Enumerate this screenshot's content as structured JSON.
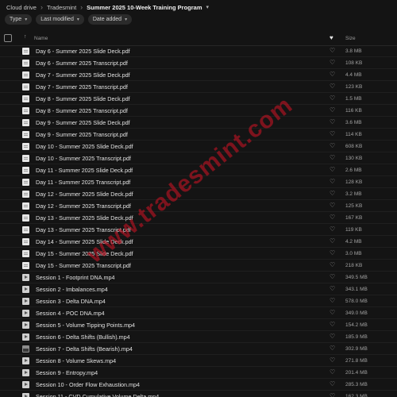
{
  "breadcrumb": {
    "root": "Cloud drive",
    "parent": "Tradesmint",
    "current": "Summer 2025 10-Week Training Program"
  },
  "filters": [
    {
      "label": "Type"
    },
    {
      "label": "Last modified"
    },
    {
      "label": "Date added"
    }
  ],
  "table_header": {
    "name": "Name",
    "size": "Size"
  },
  "watermark": "www.tradesmint.com",
  "files": [
    {
      "name": "Day 6 - Summer 2025 Slide Deck.pdf",
      "size": "3.8 MB",
      "icon": "pdf"
    },
    {
      "name": "Day 6 - Summer 2025 Transcript.pdf",
      "size": "108 KB",
      "icon": "pdf"
    },
    {
      "name": "Day 7 - Summer 2025 Slide Deck.pdf",
      "size": "4.4 MB",
      "icon": "pdf"
    },
    {
      "name": "Day 7 - Summer 2025 Transcript.pdf",
      "size": "123 KB",
      "icon": "pdf"
    },
    {
      "name": "Day 8 - Summer 2025 Slide Deck.pdf",
      "size": "1.5 MB",
      "icon": "pdf"
    },
    {
      "name": "Day 8 - Summer 2025 Transcript.pdf",
      "size": "116 KB",
      "icon": "pdf"
    },
    {
      "name": "Day 9 - Summer 2025 Slide Deck.pdf",
      "size": "3.6 MB",
      "icon": "pdf"
    },
    {
      "name": "Day 9 - Summer 2025 Transcript.pdf",
      "size": "114 KB",
      "icon": "pdf"
    },
    {
      "name": "Day 10 - Summer 2025 Slide Deck.pdf",
      "size": "608 KB",
      "icon": "pdf"
    },
    {
      "name": "Day 10 - Summer 2025 Transcript.pdf",
      "size": "130 KB",
      "icon": "pdf"
    },
    {
      "name": "Day 11 - Summer 2025 Slide Deck.pdf",
      "size": "2.6 MB",
      "icon": "pdf"
    },
    {
      "name": "Day 11 - Summer 2025 Transcript.pdf",
      "size": "128 KB",
      "icon": "pdf"
    },
    {
      "name": "Day 12 - Summer 2025 Slide Deck.pdf",
      "size": "3.2 MB",
      "icon": "pdf"
    },
    {
      "name": "Day 12 - Summer 2025 Transcript.pdf",
      "size": "125 KB",
      "icon": "pdf"
    },
    {
      "name": "Day 13 - Summer 2025 Slide Deck.pdf",
      "size": "167 KB",
      "icon": "pdf"
    },
    {
      "name": "Day 13 - Summer 2025 Transcript.pdf",
      "size": "119 KB",
      "icon": "pdf"
    },
    {
      "name": "Day 14 - Summer 2025 Slide Deck.pdf",
      "size": "4.2 MB",
      "icon": "pdf"
    },
    {
      "name": "Day 15 - Summer 2025 Slide Deck.pdf",
      "size": "3.0 MB",
      "icon": "pdf"
    },
    {
      "name": "Day 15 - Summer 2025 Transcript.pdf",
      "size": "218 KB",
      "icon": "pdf"
    },
    {
      "name": "Session 1 - Footprint DNA.mp4",
      "size": "349.5 MB",
      "icon": "mp4"
    },
    {
      "name": "Session 2 - Imbalances.mp4",
      "size": "343.1 MB",
      "icon": "mp4"
    },
    {
      "name": "Session 3 - Delta DNA.mp4",
      "size": "578.0 MB",
      "icon": "mp4"
    },
    {
      "name": "Session 4 - POC DNA.mp4",
      "size": "349.0 MB",
      "icon": "mp4"
    },
    {
      "name": "Session 5 - Volume Tipping Points.mp4",
      "size": "154.2 MB",
      "icon": "mp4"
    },
    {
      "name": "Session 6 - Delta Shifts (Bullish).mp4",
      "size": "185.9 MB",
      "icon": "mp4"
    },
    {
      "name": "Session 7 - Delta Shifts (Bearish).mp4",
      "size": "302.9 MB",
      "icon": "thumb"
    },
    {
      "name": "Session 8 - Volume Skews.mp4",
      "size": "271.8 MB",
      "icon": "mp4"
    },
    {
      "name": "Session 9 - Entropy.mp4",
      "size": "201.4 MB",
      "icon": "mp4"
    },
    {
      "name": "Session 10 - Order Flow Exhaustion.mp4",
      "size": "285.3 MB",
      "icon": "mp4"
    },
    {
      "name": "Session 11 - CVD Cumulative Volume Delta.mp4",
      "size": "162.3 MB",
      "icon": "mp4"
    }
  ]
}
